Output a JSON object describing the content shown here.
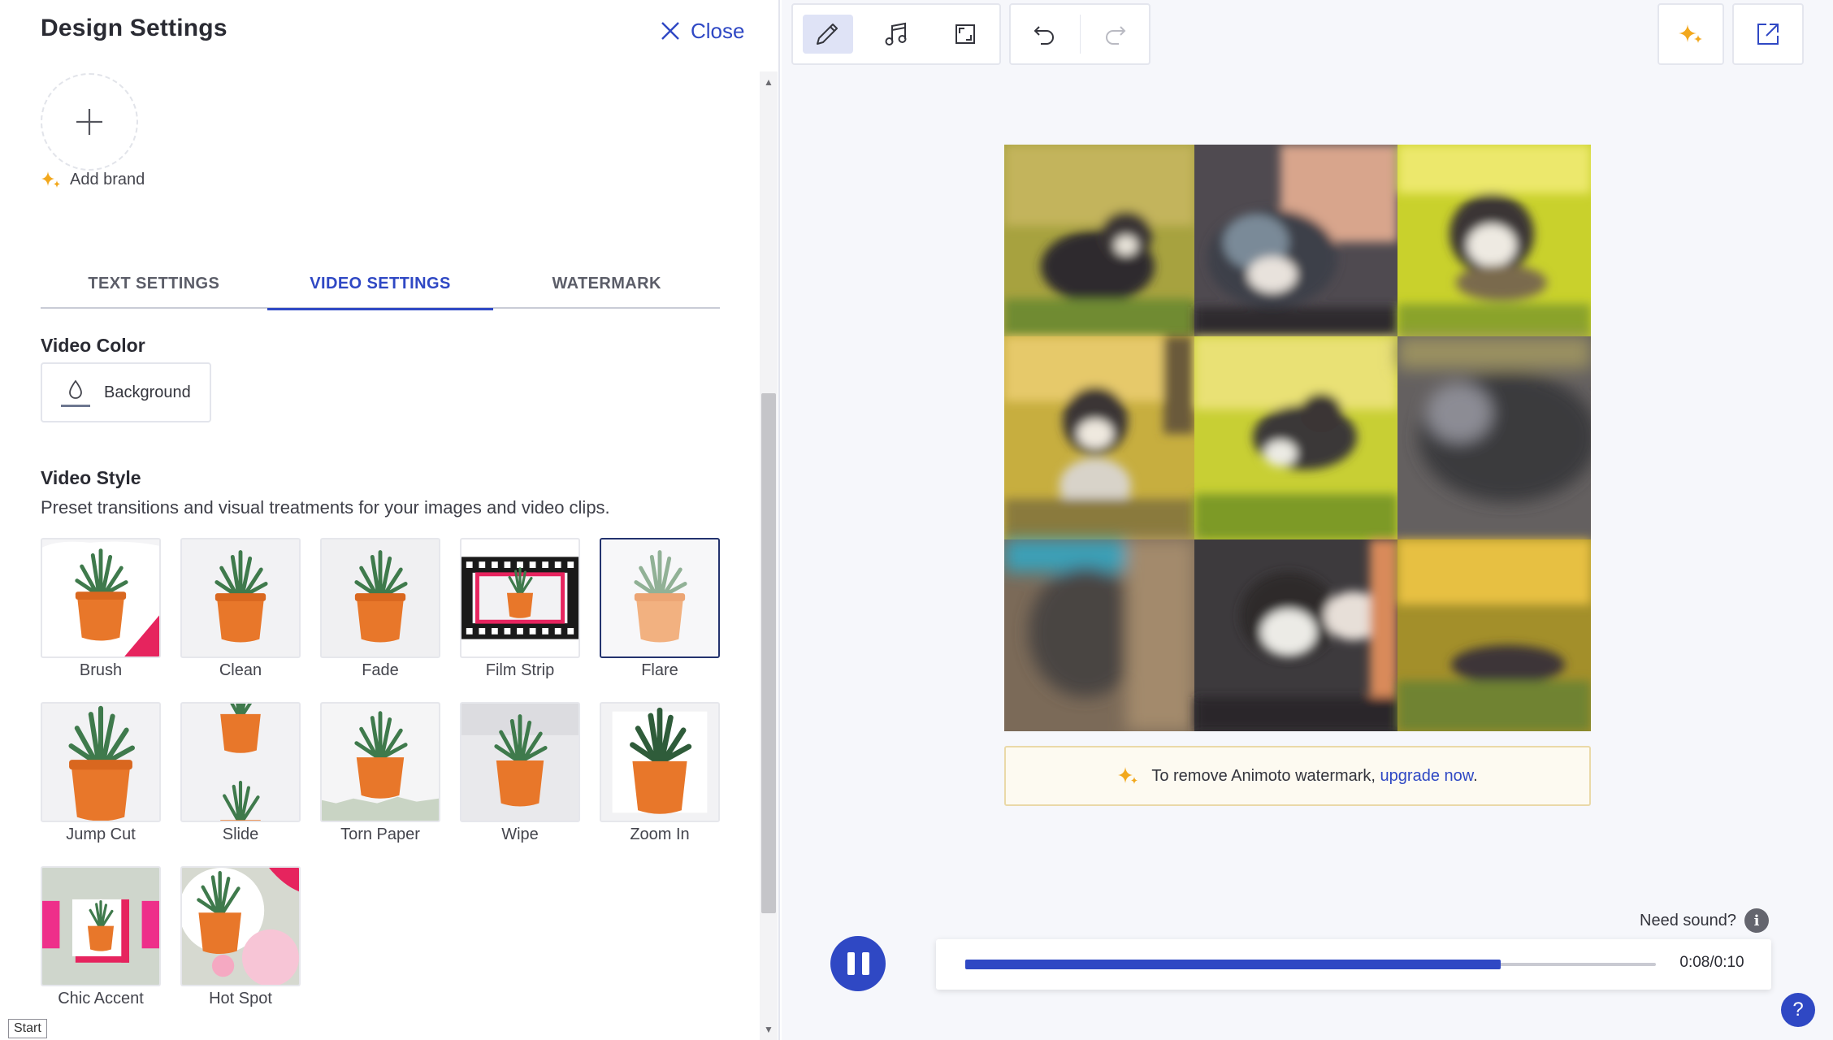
{
  "panel": {
    "title": "Design Settings",
    "close_label": "Close",
    "add_brand_label": "Add brand"
  },
  "tabs": [
    {
      "label": "TEXT SETTINGS",
      "active": false
    },
    {
      "label": "VIDEO SETTINGS",
      "active": true
    },
    {
      "label": "WATERMARK",
      "active": false
    }
  ],
  "video_color": {
    "heading": "Video Color",
    "button_label": "Background"
  },
  "video_style": {
    "heading": "Video Style",
    "description": "Preset transitions and visual treatments for your images and video clips.",
    "styles": [
      {
        "label": "Brush",
        "selected": false
      },
      {
        "label": "Clean",
        "selected": false
      },
      {
        "label": "Fade",
        "selected": false
      },
      {
        "label": "Film Strip",
        "selected": false
      },
      {
        "label": "Flare",
        "selected": true
      },
      {
        "label": "Jump Cut",
        "selected": false
      },
      {
        "label": "Slide",
        "selected": false
      },
      {
        "label": "Torn Paper",
        "selected": false
      },
      {
        "label": "Wipe",
        "selected": false
      },
      {
        "label": "Zoom In",
        "selected": false
      },
      {
        "label": "Chic Accent",
        "selected": false
      },
      {
        "label": "Hot Spot",
        "selected": false
      }
    ]
  },
  "tooltip": "Start",
  "toolbar": {
    "icons": [
      "pencil-icon",
      "music-icon",
      "resize-icon",
      "undo-icon",
      "redo-icon",
      "sparkle-icon",
      "share-icon"
    ]
  },
  "watermark": {
    "text": "To remove Animoto watermark, ",
    "link": "upgrade now",
    "suffix": "."
  },
  "player": {
    "need_sound": "Need sound?",
    "time": "0:08/0:10",
    "progress": 0.775
  },
  "help_label": "?",
  "colors": {
    "accent": "#2f48c4",
    "pot": "#e8772a",
    "watermark_bg": "#fdfaf1"
  }
}
